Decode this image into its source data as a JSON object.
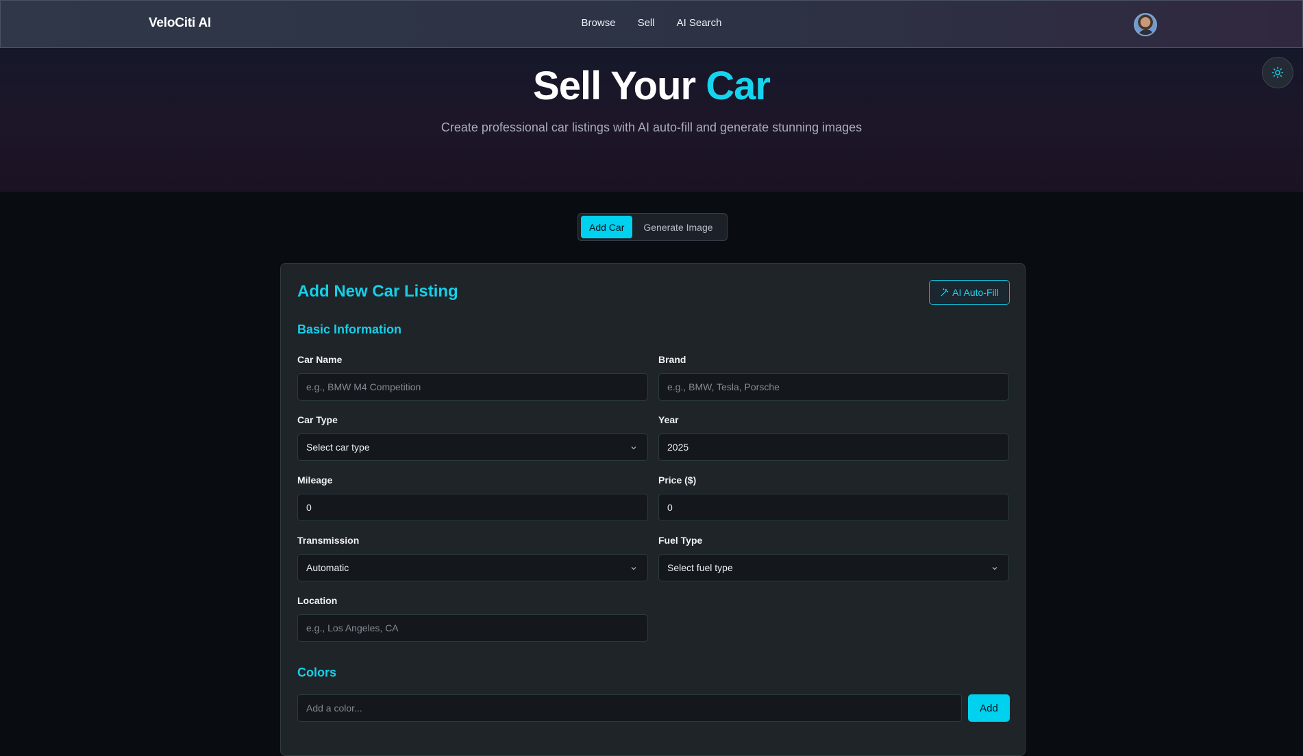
{
  "nav": {
    "brand": "VeloCiti AI",
    "links": [
      "Browse",
      "Sell",
      "AI Search"
    ]
  },
  "hero": {
    "title_main": "Sell Your",
    "title_accent": "Car",
    "subtitle": "Create professional car listings with AI auto-fill and generate stunning images"
  },
  "tabs": [
    {
      "label": "Add Car",
      "active": true
    },
    {
      "label": "Generate Image",
      "active": false
    }
  ],
  "form": {
    "title": "Add New Car Listing",
    "autofill_label": "AI Auto-Fill",
    "basic_section": "Basic Information",
    "car_name": {
      "label": "Car Name",
      "placeholder": "e.g., BMW M4 Competition",
      "value": ""
    },
    "brand": {
      "label": "Brand",
      "placeholder": "e.g., BMW, Tesla, Porsche",
      "value": ""
    },
    "car_type": {
      "label": "Car Type",
      "value": "Select car type"
    },
    "year": {
      "label": "Year",
      "value": "2025"
    },
    "mileage": {
      "label": "Mileage",
      "value": "0"
    },
    "price": {
      "label": "Price ($)",
      "value": "0"
    },
    "transmission": {
      "label": "Transmission",
      "value": "Automatic"
    },
    "fuel_type": {
      "label": "Fuel Type",
      "value": "Select fuel type"
    },
    "location": {
      "label": "Location",
      "placeholder": "e.g., Los Angeles, CA",
      "value": ""
    },
    "colors_section": "Colors",
    "color_input": {
      "placeholder": "Add a color..."
    },
    "add_label": "Add"
  },
  "colors": {
    "accent": "#00d1ef",
    "background": "#090d12",
    "card": "#1f2428"
  },
  "icons": [
    "sun-icon",
    "wand-icon",
    "chevron-down-icon"
  ]
}
